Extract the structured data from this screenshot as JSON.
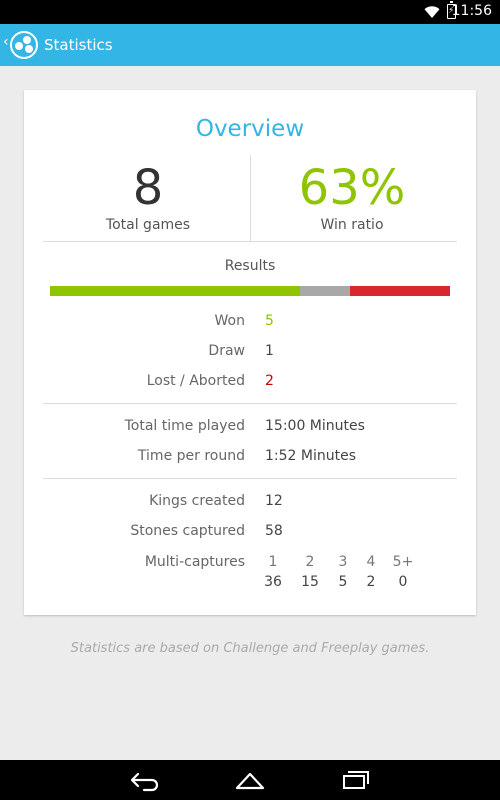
{
  "status_bar": {
    "time": "11:56",
    "battery_icon": "battery-charging-icon",
    "wifi_icon": "wifi-icon"
  },
  "action_bar": {
    "title": "Statistics",
    "icon": "app-icon",
    "up_icon": "chevron-left-icon",
    "color": "#33b5e5"
  },
  "card": {
    "overview_title": "Overview",
    "total_games": {
      "value": "8",
      "label": "Total games"
    },
    "win_ratio": {
      "value": "63%",
      "label": "Win ratio"
    },
    "results_title": "Results",
    "results_bar": [
      {
        "name": "won",
        "fraction": 0.625,
        "color": "#8ec400"
      },
      {
        "name": "draw",
        "fraction": 0.125,
        "color": "#a8a8a8"
      },
      {
        "name": "lost",
        "fraction": 0.25,
        "color": "#d9272e"
      }
    ],
    "outcomes": [
      {
        "label": "Won",
        "value": "5",
        "color": "#8ec400"
      },
      {
        "label": "Draw",
        "value": "1",
        "color": "#444444"
      },
      {
        "label": "Lost / Aborted",
        "value": "2",
        "color": "#cc0000"
      }
    ],
    "time": [
      {
        "label": "Total time played",
        "value": "15:00 Minutes"
      },
      {
        "label": "Time per round",
        "value": "1:52 Minutes"
      }
    ],
    "pieces": [
      {
        "label": "Kings created",
        "value": "12"
      },
      {
        "label": "Stones captured",
        "value": "58"
      }
    ],
    "multi_captures": {
      "label": "Multi-captures",
      "headers": [
        "1",
        "2",
        "3",
        "4",
        "5+"
      ],
      "values": [
        "36",
        "15",
        "5",
        "2",
        "0"
      ]
    }
  },
  "footnote": "Statistics are based on Challenge and Freeplay games.",
  "nav_bar": {
    "back_icon": "back-icon",
    "home_icon": "home-icon",
    "recents_icon": "recents-icon"
  }
}
